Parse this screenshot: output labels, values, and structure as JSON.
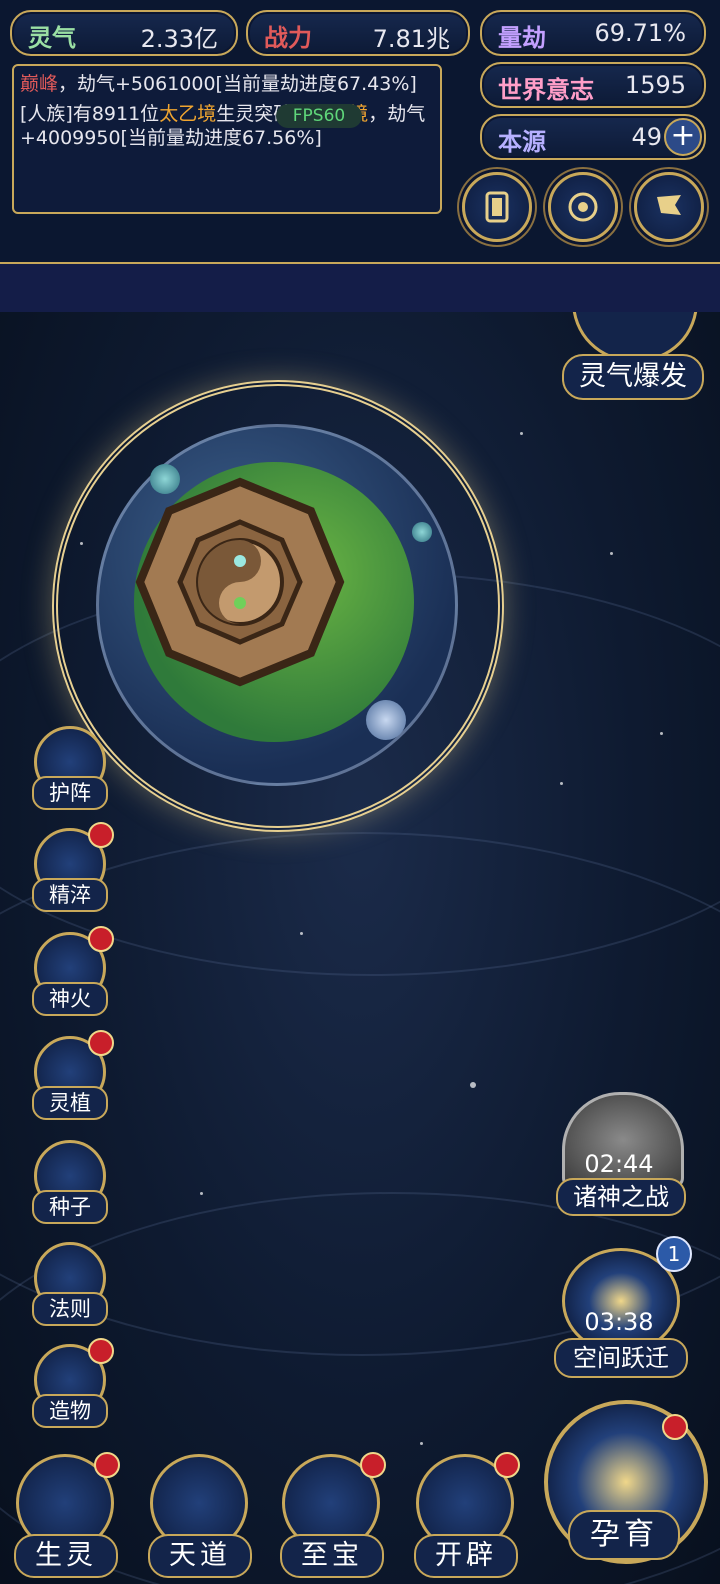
{
  "stats": {
    "lingqi": {
      "label": "灵气",
      "value": "2.33亿"
    },
    "zhanli": {
      "label": "战力",
      "value": "7.81兆"
    },
    "liangjie": {
      "label": "量劫",
      "value": "69.71%"
    },
    "shijie": {
      "label": "世界意志",
      "value": "1595"
    },
    "benyuan": {
      "label": "本源",
      "value": "49"
    }
  },
  "log": {
    "line1_highlight": "巅峰",
    "line1_rest": "，劫气+5061000[当前量劫进度67.43%]",
    "line2_a": "[人族]有8911位",
    "line2_b": "太乙境",
    "line2_c": "生灵突破至",
    "line2_d": "大罗境",
    "line2_e": "，劫气+4009950[当前量劫进度67.56%]"
  },
  "fps": "FPS60",
  "burst_label": "灵气爆发",
  "side_menu": [
    {
      "label": "护阵",
      "icon": "yin-yang-icon",
      "badge": false
    },
    {
      "label": "精淬",
      "icon": "lotus-flame-icon",
      "badge": true
    },
    {
      "label": "神火",
      "icon": "fire-icon",
      "badge": true
    },
    {
      "label": "灵植",
      "icon": "plant-icon",
      "badge": true
    },
    {
      "label": "种子",
      "icon": "flower-icon",
      "badge": false
    },
    {
      "label": "法则",
      "icon": "rule-icon",
      "badge": false
    },
    {
      "label": "造物",
      "icon": "diamond-icon",
      "badge": true
    }
  ],
  "events": {
    "war": {
      "label": "诸神之战",
      "timer": "02:44"
    },
    "leap": {
      "label": "空间跃迁",
      "timer": "03:38",
      "badge": "1"
    }
  },
  "bottom_nav": [
    {
      "label": "生灵",
      "badge": true
    },
    {
      "label": "天道",
      "badge": false
    },
    {
      "label": "至宝",
      "badge": true
    },
    {
      "label": "开辟",
      "badge": true
    }
  ],
  "incubate": {
    "label": "孕育",
    "badge": true
  },
  "colors": {
    "gold": "#c8a85a",
    "red": "#e05a5a",
    "orange": "#f0a530",
    "badge": "#c81f2a"
  }
}
